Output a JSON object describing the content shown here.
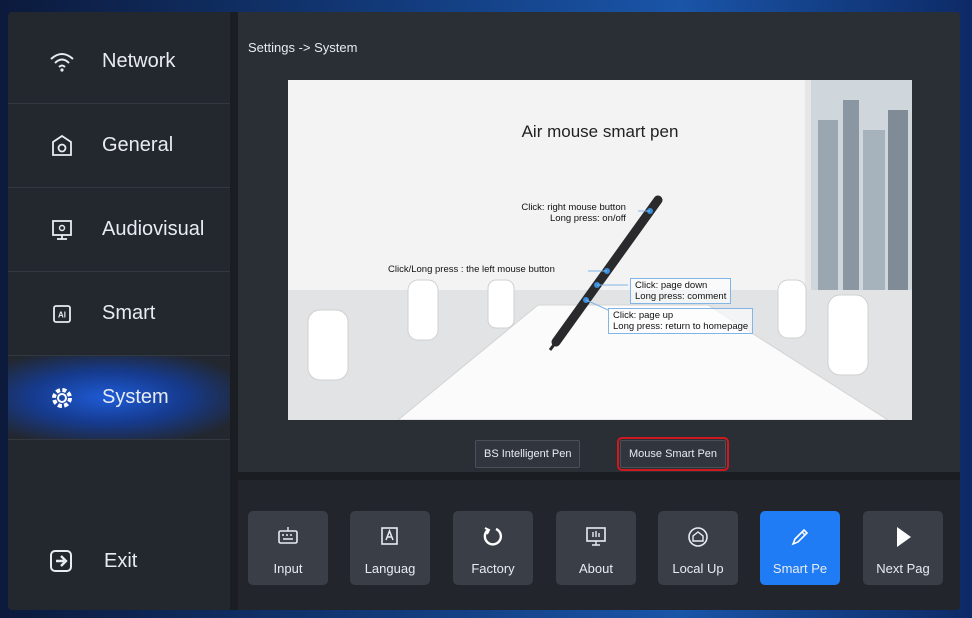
{
  "sidebar": {
    "items": [
      {
        "label": "Network",
        "icon": "wifi-icon"
      },
      {
        "label": "General",
        "icon": "general-settings-icon"
      },
      {
        "label": "Audiovisual",
        "icon": "audiovisual-icon"
      },
      {
        "label": "Smart",
        "icon": "ai-chip-icon"
      },
      {
        "label": "System",
        "icon": "system-gear-icon",
        "active": true
      }
    ],
    "exit_label": "Exit"
  },
  "breadcrumb": "Settings -> System",
  "illustration": {
    "title": "Air mouse smart pen",
    "callouts": {
      "top_1": "Click: right mouse button",
      "top_2": "Long press: on/off",
      "left": "Click/Long press : the left mouse button",
      "mid_1": "Click: page down",
      "mid_2": "Long press: comment",
      "low_1": "Click: page up",
      "low_2": "Long press: return to homepage"
    }
  },
  "pen_options": {
    "option_1": "BS Intelligent Pen",
    "option_2": "Mouse Smart Pen",
    "selected": "Mouse Smart Pen"
  },
  "toolbar": {
    "items": [
      {
        "label": "Input",
        "icon": "keyboard-icon"
      },
      {
        "label": "Languag",
        "icon": "language-icon"
      },
      {
        "label": "Factory",
        "icon": "reset-icon"
      },
      {
        "label": "About",
        "icon": "about-monitor-icon"
      },
      {
        "label": "Local Up",
        "icon": "local-upgrade-icon"
      },
      {
        "label": "Smart Pe",
        "icon": "pen-icon",
        "active": true
      },
      {
        "label": "Next Pag",
        "icon": "play-next-icon"
      }
    ]
  },
  "colors": {
    "accent": "#1f7cf5",
    "highlight_border": "#d0181f"
  }
}
